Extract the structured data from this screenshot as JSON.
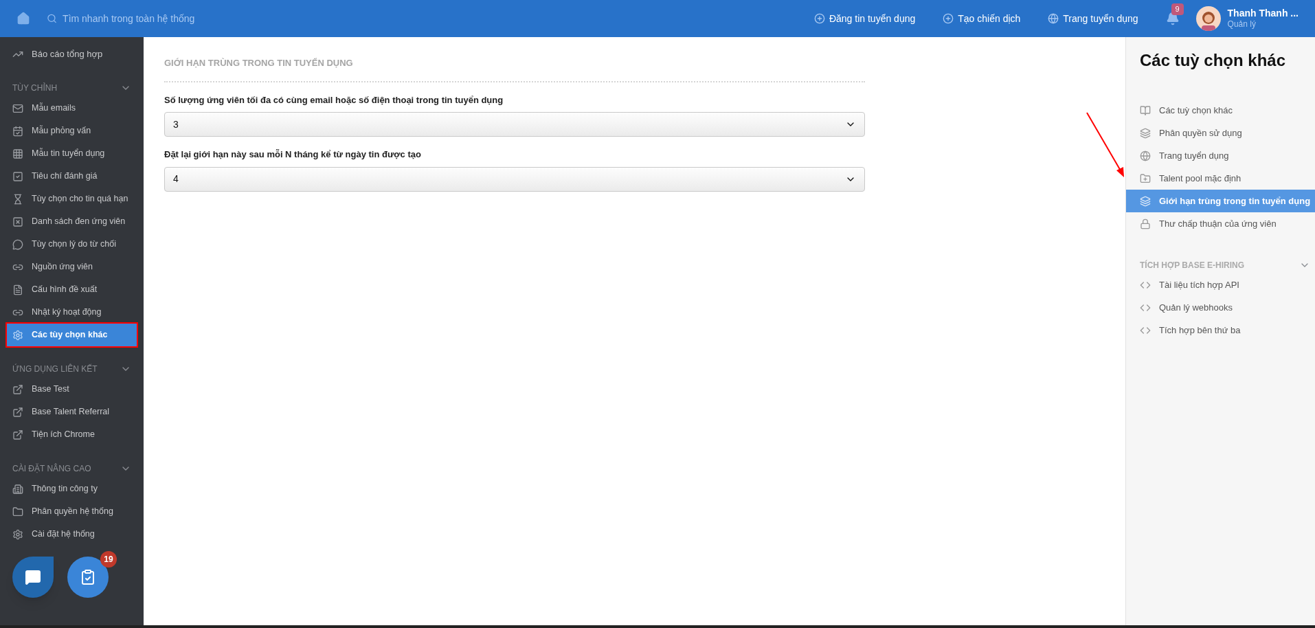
{
  "topbar": {
    "search": {
      "placeholder": "Tìm nhanh trong toàn hệ thống"
    },
    "links": [
      {
        "label": "Đăng tin tuyển dụng"
      },
      {
        "label": "Tạo chiến dịch"
      },
      {
        "label": "Trang tuyển dụng"
      }
    ],
    "notifications": {
      "count": "9"
    },
    "user": {
      "name": "Thanh Thanh ...",
      "role": "Quản lý"
    }
  },
  "sidebar": {
    "top_item": {
      "label": "Báo cáo tổng hợp",
      "selected": false
    },
    "sections": [
      {
        "title": "TÙY CHỈNH",
        "expanded": true,
        "items": [
          {
            "label": "Mẫu emails",
            "selected": false,
            "outlined": false
          },
          {
            "label": "Mẫu phỏng vấn",
            "selected": false,
            "outlined": false
          },
          {
            "label": "Mẫu tin tuyển dụng",
            "selected": false,
            "outlined": false
          },
          {
            "label": "Tiêu chí đánh giá",
            "selected": false,
            "outlined": false
          },
          {
            "label": "Tùy chọn cho tin quá hạn",
            "selected": false,
            "outlined": false
          },
          {
            "label": "Danh sách đen ứng viên",
            "selected": false,
            "outlined": false
          },
          {
            "label": "Tùy chọn lý do từ chối",
            "selected": false,
            "outlined": false
          },
          {
            "label": "Nguồn ứng viên",
            "selected": false,
            "outlined": false
          },
          {
            "label": "Cấu hình đề xuất",
            "selected": false,
            "outlined": false
          },
          {
            "label": "Nhật ký hoạt động",
            "selected": false,
            "outlined": false
          },
          {
            "label": "Các tùy chọn khác",
            "selected": true,
            "outlined": true
          }
        ]
      },
      {
        "title": "ỨNG DỤNG LIÊN KẾT",
        "expanded": true,
        "items": [
          {
            "label": "Base Test",
            "selected": false,
            "outlined": false
          },
          {
            "label": "Base Talent Referral",
            "selected": false,
            "outlined": false
          },
          {
            "label": "Tiện ích Chrome",
            "selected": false,
            "outlined": false
          }
        ]
      },
      {
        "title": "CÀI ĐẶT NÂNG CAO",
        "expanded": true,
        "items": [
          {
            "label": "Thông tin công ty",
            "selected": false,
            "outlined": false
          },
          {
            "label": "Phân quyền hệ thống",
            "selected": false,
            "outlined": false
          },
          {
            "label": "Cài đặt hệ thống",
            "selected": false,
            "outlined": false
          }
        ]
      }
    ],
    "task_badge": "19"
  },
  "main": {
    "title": "GIỚI HẠN TRÙNG TRONG TIN TUYỂN DỤNG",
    "fields": [
      {
        "label": "Số lượng ứng viên tối đa có cùng email hoặc số điện thoại trong tin tuyển dụng",
        "value": "3"
      },
      {
        "label": "Đặt lại giới hạn này sau mỗi N tháng kể từ ngày tin được tạo",
        "value": "4"
      }
    ]
  },
  "right_panel": {
    "title": "Các tuỳ chọn khác",
    "items": [
      {
        "label": "Các tuỳ chọn khác",
        "selected": false
      },
      {
        "label": "Phân quyền sử dụng",
        "selected": false
      },
      {
        "label": "Trang tuyển dụng",
        "selected": false
      },
      {
        "label": "Talent pool mặc định",
        "selected": false
      },
      {
        "label": "Giới hạn trùng trong tin tuyển dụng",
        "selected": true
      },
      {
        "label": "Thư chấp thuận của ứng viên",
        "selected": false
      }
    ],
    "section": {
      "title": "TÍCH HỢP BASE E-HIRING",
      "expanded": true,
      "items": [
        {
          "label": "Tài liệu tích hợp API",
          "selected": false
        },
        {
          "label": "Quản lý webhooks",
          "selected": false
        },
        {
          "label": "Tích hợp bên thứ ba",
          "selected": false
        }
      ]
    }
  }
}
